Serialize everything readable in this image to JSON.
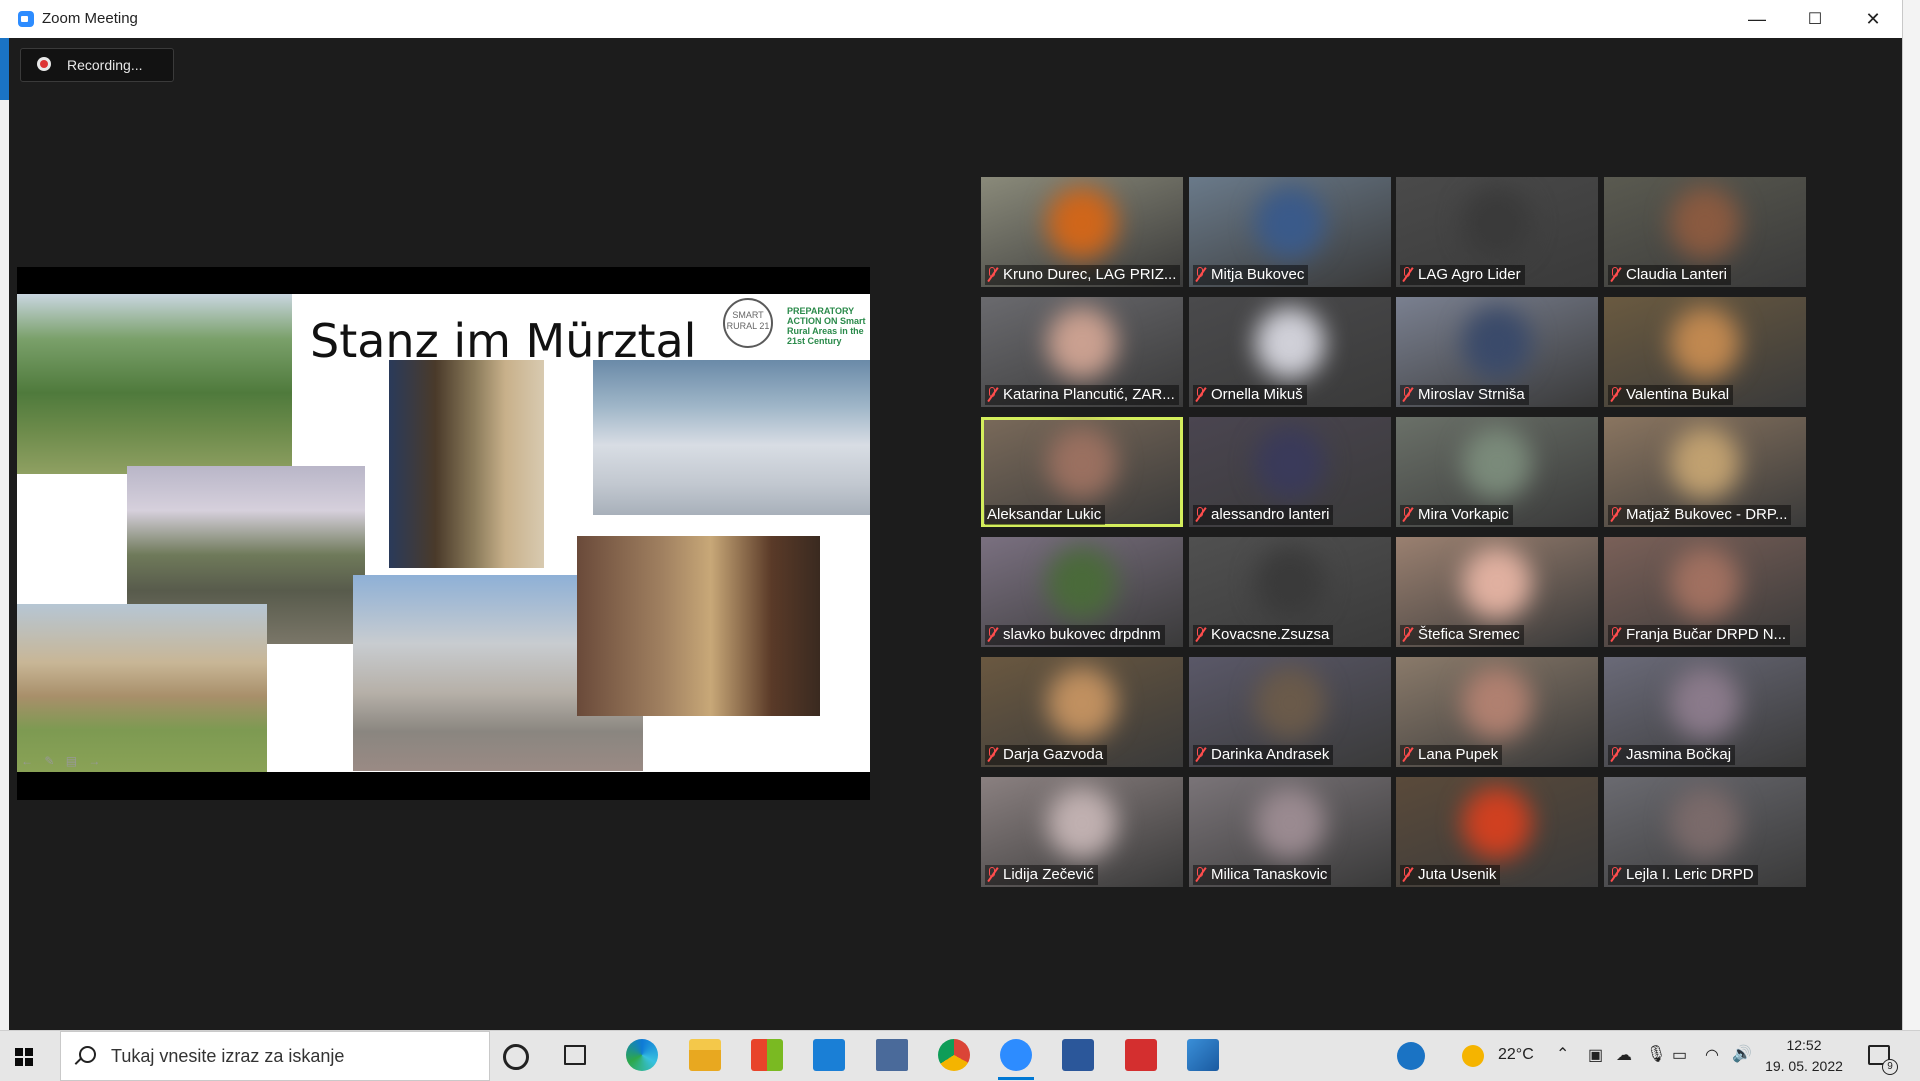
{
  "window": {
    "title": "Zoom Meeting",
    "minimize": "—",
    "maximize": "☐",
    "close": "✕"
  },
  "recording": {
    "label": "Recording..."
  },
  "slide": {
    "title": "Stanz im Mürztal",
    "logo_text": "SMART RURAL 21",
    "logo_caption": "PREPARATORY ACTION ON Smart Rural Areas in the 21st Century",
    "nav": "← ✎ ▤ →"
  },
  "participants": [
    {
      "name": "Kruno Durec, LAG PRIZ...",
      "muted": true
    },
    {
      "name": "Mitja Bukovec",
      "muted": true
    },
    {
      "name": "LAG Agro Lider",
      "muted": true
    },
    {
      "name": "Claudia Lanteri",
      "muted": true
    },
    {
      "name": "Katarina Plancutić, ZAR...",
      "muted": true
    },
    {
      "name": "Ornella Mikuš",
      "muted": true
    },
    {
      "name": "Miroslav Strniša",
      "muted": true
    },
    {
      "name": "Valentina Bukal",
      "muted": true
    },
    {
      "name": "Aleksandar Lukic",
      "muted": false,
      "active_speaker": true
    },
    {
      "name": "alessandro lanteri",
      "muted": true
    },
    {
      "name": "Mira Vorkapic",
      "muted": true
    },
    {
      "name": "Matjaž Bukovec - DRP...",
      "muted": true
    },
    {
      "name": "slavko bukovec drpdnm",
      "muted": true
    },
    {
      "name": "Kovacsne.Zsuzsa",
      "muted": true
    },
    {
      "name": "Štefica Sremec",
      "muted": true
    },
    {
      "name": "Franja Bučar DRPD N...",
      "muted": true
    },
    {
      "name": "Darja Gazvoda",
      "muted": true
    },
    {
      "name": "Darinka Andrasek",
      "muted": true
    },
    {
      "name": "Lana Pupek",
      "muted": true
    },
    {
      "name": "Jasmina Bočkaj",
      "muted": true
    },
    {
      "name": "Lidija Zečević",
      "muted": true
    },
    {
      "name": "Milica Tanaskovic",
      "muted": true
    },
    {
      "name": "Juta Usenik",
      "muted": true
    },
    {
      "name": "Lejla I. Leric DRPD",
      "muted": true
    }
  ],
  "taskbar": {
    "search_placeholder": "Tukaj vnesite izraz za iskanje",
    "apps": [
      "cortana-icon",
      "task-view-icon",
      "edge-icon",
      "file-explorer-icon",
      "store-icon",
      "mail-icon",
      "calculator-icon",
      "chrome-icon",
      "zoom-icon",
      "word-icon",
      "acrobat-icon",
      "photos-icon"
    ],
    "temperature": "22°C",
    "time": "12:52",
    "date": "19. 05. 2022",
    "notification_count": "9"
  }
}
